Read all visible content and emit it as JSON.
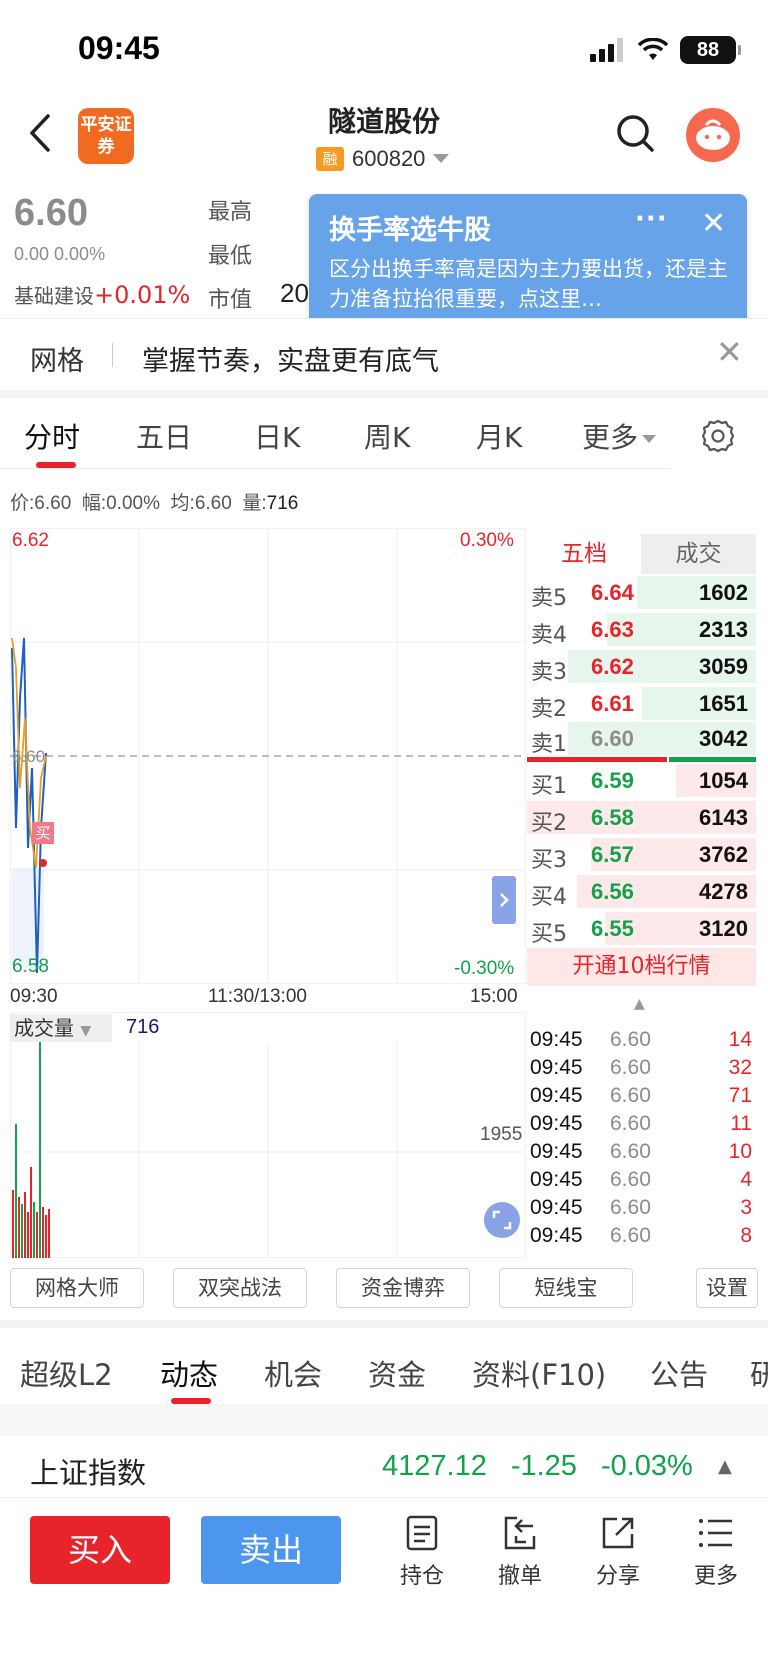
{
  "status": {
    "time": "09:45",
    "battery": "88"
  },
  "header": {
    "title": "隧道股份",
    "logo": "平安证券",
    "rong_tag": "融",
    "code": "600820"
  },
  "quote": {
    "price": "6.60",
    "change": "0.00 0.00%",
    "sector_name": "基础建设",
    "sector_change": "+0.01%",
    "high_label": "最高",
    "low_label": "最低",
    "mktcap_label": "市值",
    "mktcap_value_partial": "20"
  },
  "popup": {
    "title": "换手率选牛股",
    "more": "···",
    "close": "✕",
    "text": "区分出换手率高是因为主力要出货，还是主力准备拉抬很重要，点这里…"
  },
  "banner": {
    "tag": "网格",
    "text": "掌握节奏，实盘更有底气",
    "close": "✕"
  },
  "chart_tabs": [
    "分时",
    "五日",
    "日K",
    "周K",
    "月K",
    "更多"
  ],
  "infobar": {
    "price_label": "价:",
    "price": "6.60",
    "amp_label": "幅:",
    "amp": "0.00%",
    "avg_label": "均:",
    "avg": "6.60",
    "vol_label": "量:",
    "vol": "716"
  },
  "chart_labels": {
    "top_price": "6.62",
    "top_pct": "0.30%",
    "bottom_price": "6.58",
    "bottom_pct": "-0.30%",
    "mid_price": "6.60",
    "buy_marker": "买",
    "time_start": "09:30",
    "time_mid": "11:30/13:00",
    "time_end": "15:00",
    "vol_label": "成交量",
    "vol_value": "716",
    "vol_max": "1955"
  },
  "orderbook": {
    "tab_levels": "五档",
    "tab_trades": "成交",
    "asks": [
      {
        "label": "卖5",
        "price": "6.64",
        "qty": "1602",
        "ratio": 0.52
      },
      {
        "label": "卖4",
        "price": "6.63",
        "qty": "2313",
        "ratio": 0.65
      },
      {
        "label": "卖3",
        "price": "6.62",
        "qty": "3059",
        "ratio": 0.82
      },
      {
        "label": "卖2",
        "price": "6.61",
        "qty": "1651",
        "ratio": 0.5
      },
      {
        "label": "卖1",
        "price": "6.60",
        "qty": "3042",
        "ratio": 0.82
      }
    ],
    "bids": [
      {
        "label": "买1",
        "price": "6.59",
        "qty": "1054",
        "ratio": 0.35
      },
      {
        "label": "买2",
        "price": "6.58",
        "qty": "6143",
        "ratio": 1.0
      },
      {
        "label": "买3",
        "price": "6.57",
        "qty": "3762",
        "ratio": 0.72
      },
      {
        "label": "买4",
        "price": "6.56",
        "qty": "4278",
        "ratio": 0.78
      },
      {
        "label": "买5",
        "price": "6.55",
        "qty": "3120",
        "ratio": 0.66
      }
    ],
    "open_ten": "开通10档行情"
  },
  "ticks": [
    {
      "time": "09:45",
      "price": "6.60",
      "vol": "14"
    },
    {
      "time": "09:45",
      "price": "6.60",
      "vol": "32"
    },
    {
      "time": "09:45",
      "price": "6.60",
      "vol": "71"
    },
    {
      "time": "09:45",
      "price": "6.60",
      "vol": "11"
    },
    {
      "time": "09:45",
      "price": "6.60",
      "vol": "10"
    },
    {
      "time": "09:45",
      "price": "6.60",
      "vol": "4"
    },
    {
      "time": "09:45",
      "price": "6.60",
      "vol": "3"
    },
    {
      "time": "09:45",
      "price": "6.60",
      "vol": "8"
    }
  ],
  "tools": [
    "网格大师",
    "双突战法",
    "资金博弈",
    "短线宝",
    "设置"
  ],
  "bottom_tabs": [
    "超级L2",
    "动态",
    "机会",
    "资金",
    "资料(F10)",
    "公告",
    "研"
  ],
  "index": {
    "name": "上证指数",
    "value": "4127.12",
    "change": "-1.25",
    "pct": "-0.03%"
  },
  "actions": {
    "buy": "买入",
    "sell": "卖出",
    "position": "持仓",
    "cancel": "撤单",
    "share": "分享",
    "more": "更多"
  },
  "colors": {
    "up": "#e8242b",
    "down": "#14a14a",
    "brand": "#f26a21",
    "sell_blue": "#4d96f0"
  }
}
